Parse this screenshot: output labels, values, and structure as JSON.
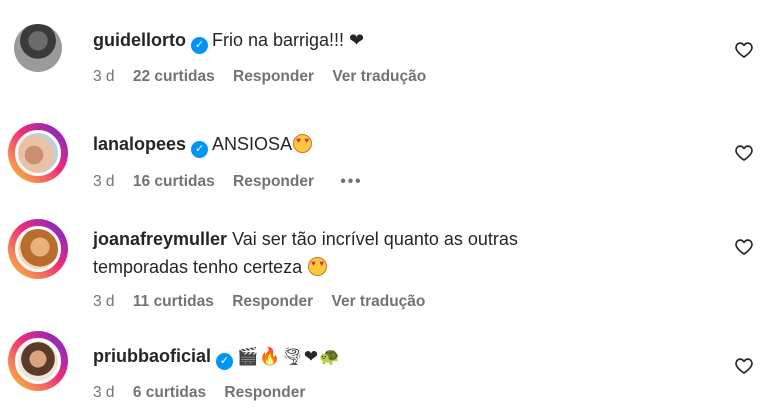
{
  "comments": [
    {
      "username": "guidellorto",
      "verified": true,
      "text": "Frio na barriga!!! ❤",
      "time": "3 d",
      "likes": "22 curtidas",
      "reply": "Responder",
      "translate": "Ver tradução"
    },
    {
      "username": "lanalopees",
      "verified": true,
      "text": "ANSIOSA",
      "emoji": "heart-eyes-emoji",
      "time": "3 d",
      "likes": "16 curtidas",
      "reply": "Responder",
      "more": "•••"
    },
    {
      "username": "joanafreymuller",
      "verified": false,
      "text_line1": "Vai ser tão incrível quanto as outras",
      "text_line2": "temporadas tenho certeza",
      "emoji": "heart-eyes-emoji",
      "time": "3 d",
      "likes": "11 curtidas",
      "reply": "Responder",
      "translate": "Ver tradução"
    },
    {
      "username": "priubbaoficial",
      "verified": true,
      "text": "🎬🔥🌪❤🐢",
      "time": "3 d",
      "likes": "6 curtidas",
      "reply": "Responder"
    }
  ],
  "icons": {
    "verified": "verified-badge-icon",
    "like": "heart-outline-icon"
  },
  "colors": {
    "text": "#262626",
    "meta": "#737373",
    "verified": "#0095f6",
    "story_ring_start": "#f9ce34",
    "story_ring_mid": "#ee2a7b",
    "story_ring_end": "#6228d7"
  }
}
